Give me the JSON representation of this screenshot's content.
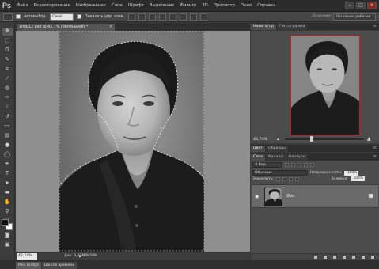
{
  "app": {
    "logo": "Ps"
  },
  "menu": [
    "Файл",
    "Редактирование",
    "Изображение",
    "Слои",
    "Шрифт",
    "Выделение",
    "Фильтр",
    "3D",
    "Просмотр",
    "Окно",
    "Справка"
  ],
  "options": {
    "autoselect_label": "Автовыбор:",
    "autoselect_value": "Слой",
    "transform_label": "Показать упр. элем.",
    "mode_3d": "3D-режим:",
    "workspace": "Основная рабочая"
  },
  "document": {
    "tab_title": "1fold12.psd @ 42,7% (Зеленый/8) *",
    "zoom": "42,74%",
    "doc_info": "Док: 3,67M/9,56M"
  },
  "bottom_tabs": [
    "Mini Bridge",
    "Шкала времени"
  ],
  "navigator": {
    "tabs": [
      "Навигатор",
      "Гистограмма"
    ],
    "zoom": "42,74%"
  },
  "color_panel": {
    "tabs": [
      "Цвет",
      "Образцы"
    ]
  },
  "layers_panel": {
    "tabs": [
      "Слои",
      "Каналы",
      "Контуры"
    ],
    "filter_label": "Вид",
    "blend_mode": "Обычные",
    "opacity_label": "Непрозрачность:",
    "opacity_value": "100%",
    "lock_label": "Закрепить:",
    "fill_label": "Заливка:",
    "fill_value": "100%",
    "layer_name": "Фон"
  },
  "tools": [
    "move-tool",
    "marquee-tool",
    "lasso-tool",
    "quick-select-tool",
    "crop-tool",
    "eyedropper-tool",
    "healing-tool",
    "brush-tool",
    "clone-stamp-tool",
    "history-brush-tool",
    "eraser-tool",
    "gradient-tool",
    "blur-tool",
    "dodge-tool",
    "pen-tool",
    "type-tool",
    "path-select-tool",
    "shape-tool",
    "hand-tool",
    "zoom-tool"
  ]
}
